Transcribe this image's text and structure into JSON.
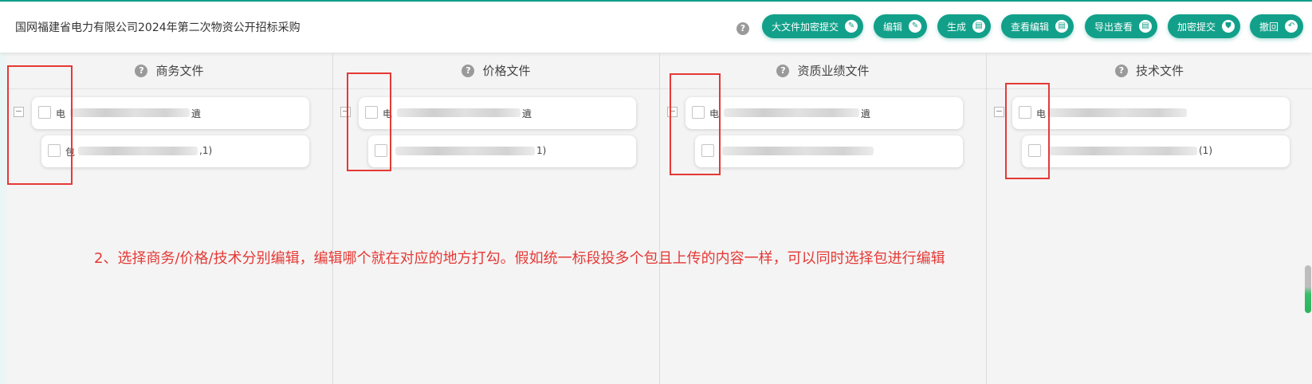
{
  "header": {
    "title": "国网福建省电力有限公司2024年第二次物资公开招标采购",
    "help_glyph": "?",
    "buttons": [
      {
        "label": "大文件加密提交",
        "icon": "edit-icon",
        "glyph": "✎"
      },
      {
        "label": "编辑",
        "icon": "edit-icon",
        "glyph": "✎"
      },
      {
        "label": "生成",
        "icon": "file-icon",
        "glyph": "▤"
      },
      {
        "label": "查看编辑",
        "icon": "file-icon",
        "glyph": "▤"
      },
      {
        "label": "导出查看",
        "icon": "file-icon",
        "glyph": "▤"
      },
      {
        "label": "加密提交",
        "icon": "shield-icon",
        "glyph": "⛊"
      },
      {
        "label": "撤回",
        "icon": "undo-icon",
        "glyph": "↶"
      }
    ]
  },
  "columns": [
    {
      "title": "商务文件",
      "parent_text": "电",
      "parent_suffix": "遺",
      "child_text": "包",
      "child_suffix": ",1)"
    },
    {
      "title": "价格文件",
      "parent_text": "电",
      "parent_suffix": "遺",
      "child_text": "",
      "child_suffix": "1)"
    },
    {
      "title": "资质业绩文件",
      "parent_text": "电",
      "parent_suffix": "遺",
      "child_text": "",
      "child_suffix": ""
    },
    {
      "title": "技术文件",
      "parent_text": "电",
      "parent_suffix": "",
      "child_text": "",
      "child_suffix": "(1)"
    }
  ],
  "collapse_glyph": "−",
  "annotation": {
    "instruction": "2、选择商务/价格/技术分别编辑，编辑哪个就在对应的地方打勾。假如统一标段投多个包且上传的内容一样，可以同时选择包进行编辑",
    "color": "#e53935"
  },
  "colors": {
    "accent": "#12a08a",
    "annotation_red": "#e53935"
  }
}
